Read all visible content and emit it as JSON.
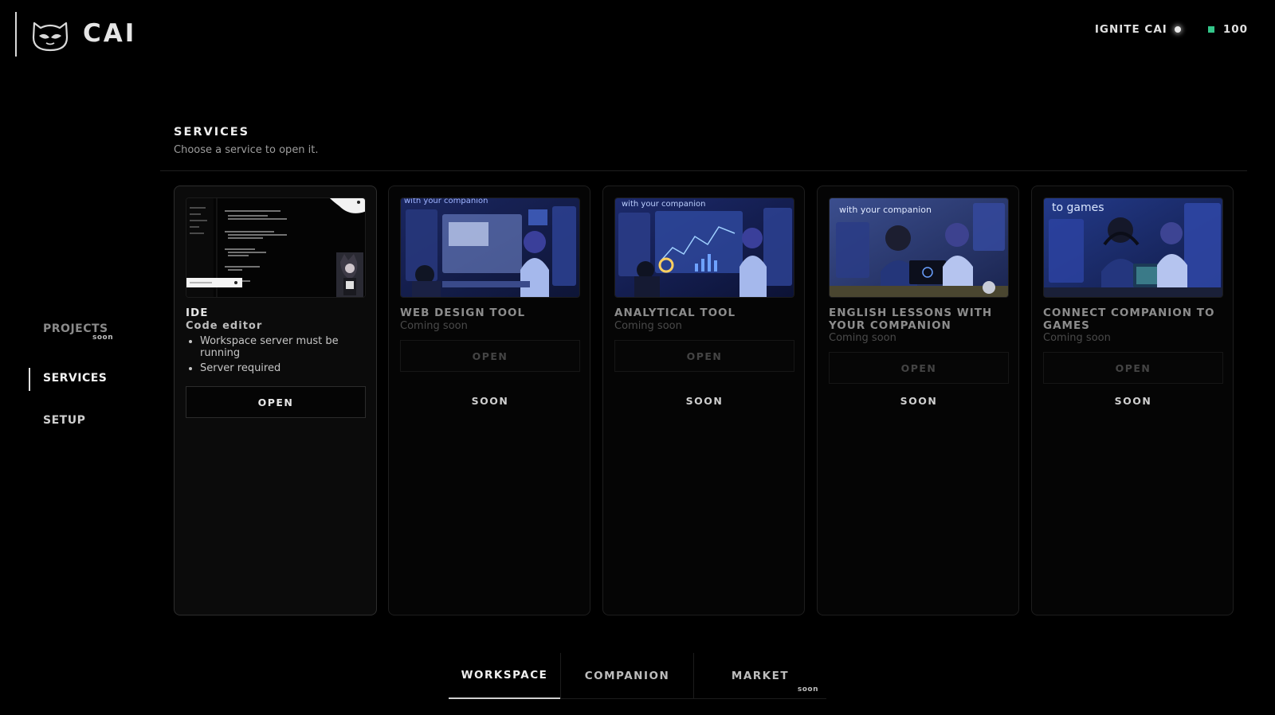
{
  "brand": {
    "name": "CAI",
    "logo_icon": "mascot-logo-icon"
  },
  "header_right": {
    "ignite_label": "IGNITE CAI",
    "credits": "100",
    "credit_color": "#34c68a"
  },
  "nav": {
    "items": [
      {
        "label": "PROJECTS",
        "badge": "soon",
        "state": "disabled"
      },
      {
        "label": "SERVICES",
        "state": "active"
      },
      {
        "label": "SETUP",
        "state": "normal"
      }
    ]
  },
  "services": {
    "title": "SERVICES",
    "subtitle": "Choose a service to open it.",
    "cards": [
      {
        "title": "IDE",
        "subtitle": "Code editor",
        "bullets": [
          "Workspace server must be running",
          "Server required"
        ],
        "open_label": "OPEN",
        "enabled": true
      },
      {
        "title": "WEB DESIGN TOOL",
        "subtitle": "Coming soon",
        "open_label": "OPEN",
        "soon_label": "SOON",
        "thumb_text": "with your companion",
        "enabled": false
      },
      {
        "title": "ANALYTICAL TOOL",
        "subtitle": "Coming soon",
        "open_label": "OPEN",
        "soon_label": "SOON",
        "thumb_text": "with your companion",
        "enabled": false
      },
      {
        "title": "ENGLISH LESSONS WITH YOUR COMPANION",
        "subtitle": "Coming soon",
        "open_label": "OPEN",
        "soon_label": "SOON",
        "thumb_text": "with your companion",
        "enabled": false
      },
      {
        "title": "CONNECT COMPANION TO GAMES",
        "subtitle": "Coming soon",
        "open_label": "OPEN",
        "soon_label": "SOON",
        "thumb_text": "to games",
        "enabled": false
      }
    ]
  },
  "tabs": [
    {
      "label": "WORKSPACE",
      "active": true
    },
    {
      "label": "COMPANION",
      "active": false
    },
    {
      "label": "MARKET",
      "badge": "soon",
      "active": false
    }
  ]
}
